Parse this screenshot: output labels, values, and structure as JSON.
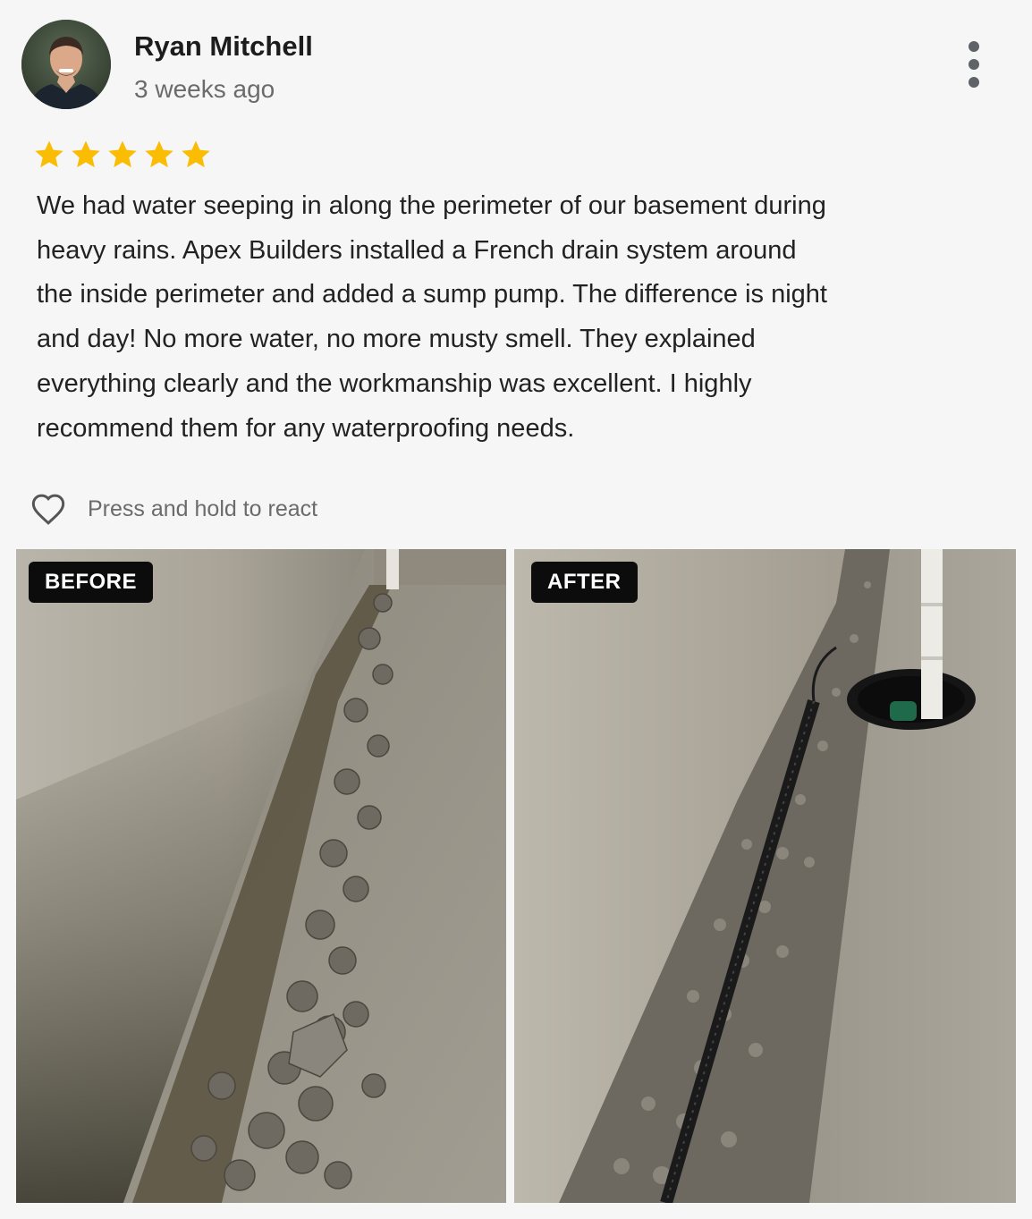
{
  "review": {
    "author": "Ryan Mitchell",
    "time": "3 weeks ago",
    "rating": 5,
    "star_color": "#fbbc04",
    "text_lines": [
      "We had water seeping in along the perimeter of our basement during",
      "heavy rains. Apex Builders installed a French drain system around",
      "the inside perimeter and added a sump pump. The difference is night",
      "and day! No more water, no more musty smell. They explained",
      "everything clearly and the workmanship was excellent. I highly",
      "recommend them for any waterproofing needs."
    ],
    "react_label": "Press and hold to react"
  },
  "photos": [
    {
      "label": "BEFORE"
    },
    {
      "label": "AFTER"
    }
  ],
  "icons": {
    "more": "more-vert-icon",
    "heart": "heart-outline-icon",
    "star": "star-icon"
  }
}
